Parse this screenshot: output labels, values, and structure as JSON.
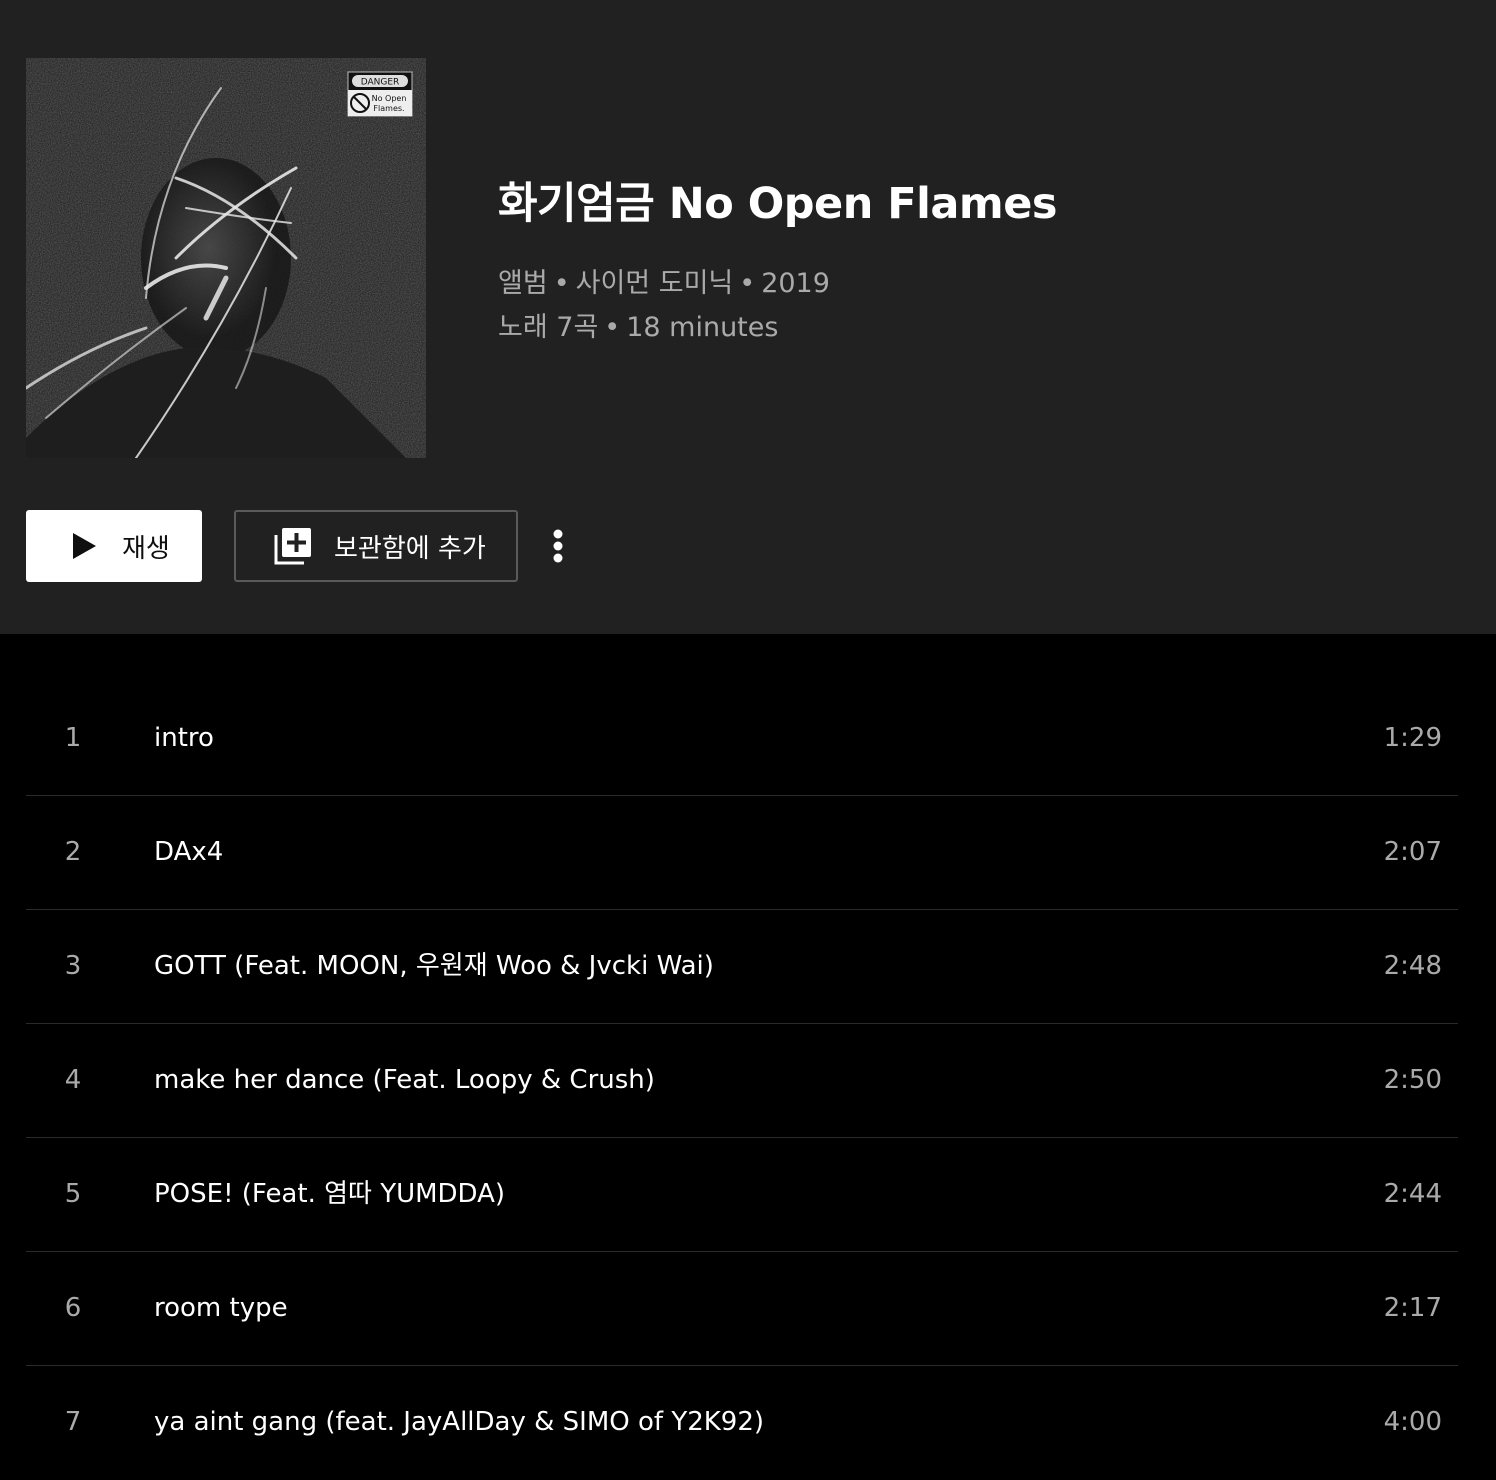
{
  "album": {
    "title": "화기엄금 No Open Flames",
    "type": "앨범",
    "artist": "사이먼 도미닉",
    "year": "2019",
    "track_count": "노래 7곡",
    "duration": "18 minutes",
    "separator": "•",
    "art_badge": {
      "top": "DANGER",
      "line1": "No Open",
      "line2": "Flames."
    }
  },
  "actions": {
    "play_label": "재생",
    "library_label": "보관함에 추가",
    "play_icon": "play-icon",
    "library_icon": "library-add-icon",
    "more_icon": "more-vert-icon"
  },
  "tracks": [
    {
      "number": "1",
      "title": "intro",
      "duration": "1:29"
    },
    {
      "number": "2",
      "title": "DAx4",
      "duration": "2:07"
    },
    {
      "number": "3",
      "title": "GOTT (Feat. MOON, 우원재 Woo & Jvcki Wai)",
      "duration": "2:48"
    },
    {
      "number": "4",
      "title": "make her dance (Feat. Loopy & Crush)",
      "duration": "2:50"
    },
    {
      "number": "5",
      "title": "POSE! (Feat. 염따 YUMDDA)",
      "duration": "2:44"
    },
    {
      "number": "6",
      "title": "room type",
      "duration": "2:17"
    },
    {
      "number": "7",
      "title": "ya aint gang (feat. JayAllDay & SIMO of Y2K92)",
      "duration": "4:00"
    }
  ],
  "colors": {
    "header_bg": "#212121",
    "page_bg": "#000000",
    "primary_text": "#ffffff",
    "secondary_text": "#aaaaaa",
    "divider": "#2a2a2a"
  }
}
